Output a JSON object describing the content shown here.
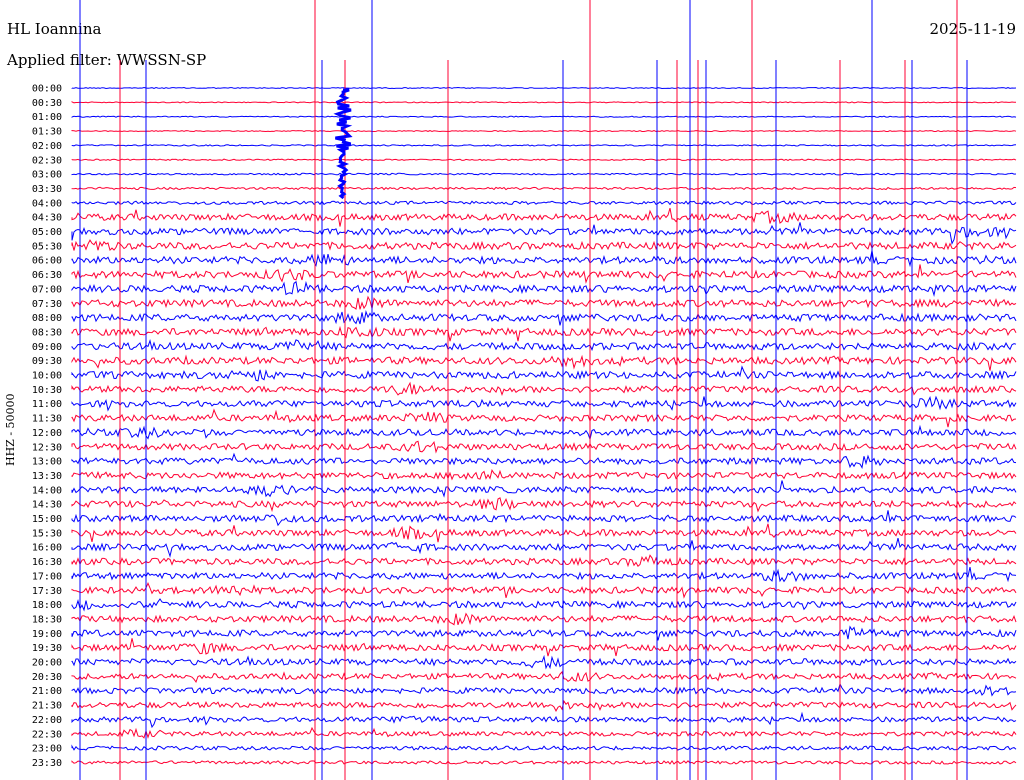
{
  "header": {
    "station": "HL Ioannina",
    "date": "2025-11-19",
    "filter": "Applied filter: WWSSN-SP"
  },
  "chart_data": {
    "type": "seismogram-helicorder",
    "title": "HL Ioannina",
    "date": "2025-11-19",
    "filter": "WWSSN-SP",
    "ylabel": "HHZ - 50000",
    "row_interval_minutes": 30,
    "rows": [
      "00:00",
      "00:30",
      "01:00",
      "01:30",
      "02:00",
      "02:30",
      "03:00",
      "03:30",
      "04:00",
      "04:30",
      "05:00",
      "05:30",
      "06:00",
      "06:30",
      "07:00",
      "07:30",
      "08:00",
      "08:30",
      "09:00",
      "09:30",
      "10:00",
      "10:30",
      "11:00",
      "11:30",
      "12:00",
      "12:30",
      "13:00",
      "13:30",
      "14:00",
      "14:30",
      "15:00",
      "15:30",
      "16:00",
      "16:30",
      "17:00",
      "17:30",
      "18:00",
      "18:30",
      "19:00",
      "19:30",
      "20:00",
      "20:30",
      "21:00",
      "21:30",
      "22:00",
      "22:30",
      "23:00",
      "23:30"
    ],
    "trace_colors": [
      "#0000ff",
      "#ff0033"
    ],
    "noise_level_by_row": [
      0.15,
      0.15,
      0.15,
      0.15,
      0.2,
      0.2,
      0.25,
      0.35,
      0.5,
      1.0,
      1.0,
      1.1,
      1.1,
      1.1,
      1.1,
      1.1,
      1.1,
      1.1,
      1.1,
      1.1,
      1.1,
      1.0,
      1.0,
      1.0,
      1.0,
      1.0,
      1.0,
      1.0,
      1.0,
      1.0,
      1.0,
      1.0,
      1.0,
      1.0,
      1.0,
      1.0,
      1.0,
      1.0,
      1.0,
      1.0,
      1.0,
      0.9,
      0.9,
      0.9,
      0.8,
      0.7,
      0.6,
      0.5
    ]
  }
}
